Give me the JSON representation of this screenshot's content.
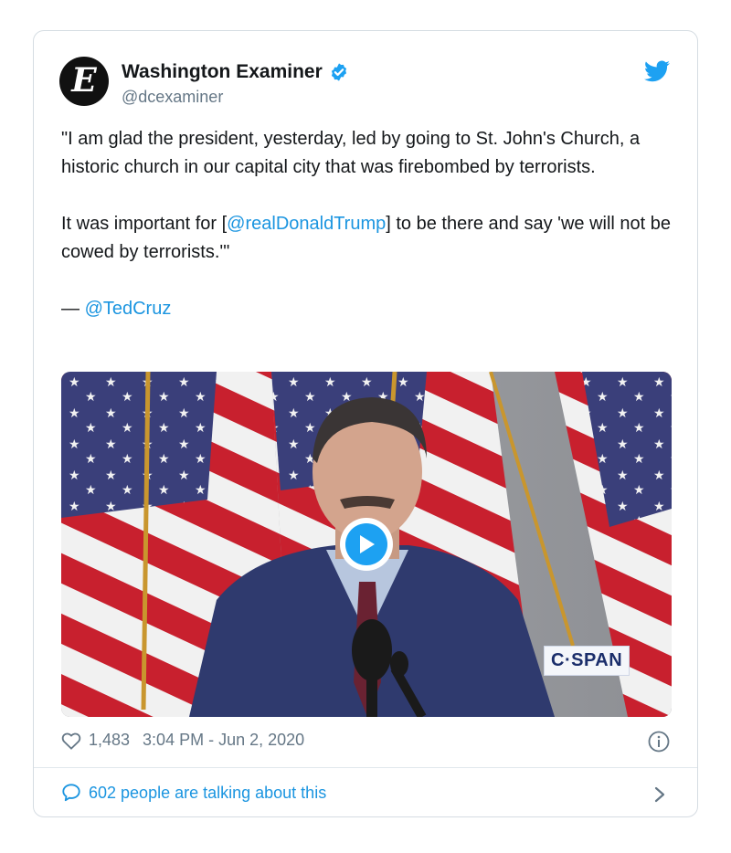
{
  "tweet": {
    "author": {
      "avatar_letter": "E",
      "display_name": "Washington Examiner",
      "handle": "@dcexaminer",
      "verified": true
    },
    "text": {
      "p1": "\"I am glad the president, yesterday, led by going to St. John's Church, a historic church in our capital city that was firebombed by terrorists.",
      "p2_before": "It was important for [",
      "p2_mention": "@realDonaldTrump",
      "p2_after": "] to be there and say 'we will not be cowed by terrorists.'\"",
      "p3_prefix": "— ",
      "p3_mention": "@TedCruz"
    },
    "media": {
      "watermark": "C·SPAN",
      "type": "video"
    },
    "likes": "1,483",
    "timestamp": "3:04 PM - Jun 2, 2020",
    "talking": "602 people are talking about this"
  },
  "colors": {
    "link": "#1b95e0",
    "twitter_blue": "#1da1f2",
    "secondary_text": "#657786"
  },
  "icons": [
    "verified-badge-icon",
    "twitter-bird-icon",
    "play-icon",
    "heart-icon",
    "info-icon",
    "chat-bubble-icon",
    "chevron-right-icon"
  ]
}
